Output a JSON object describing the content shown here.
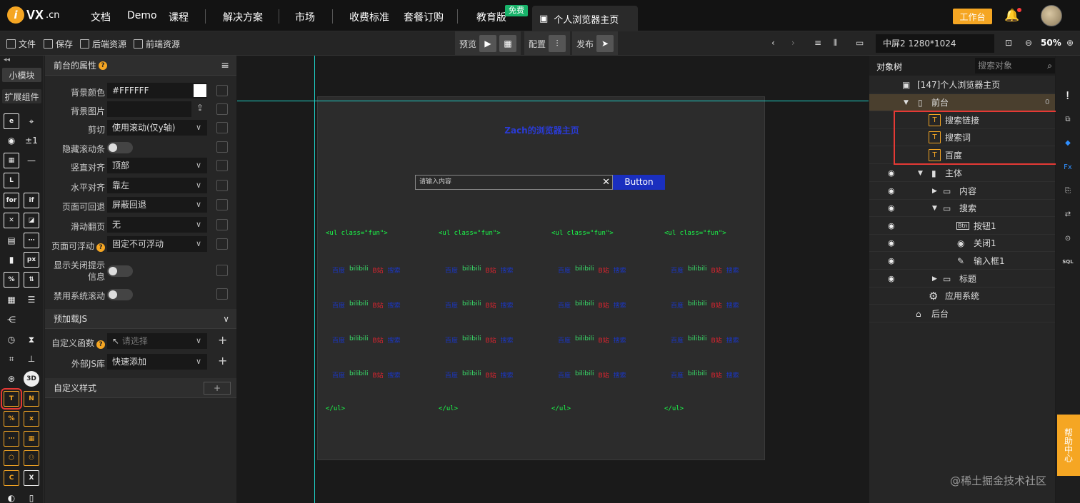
{
  "nav": {
    "logo_letter": "i",
    "logo_text": "VX",
    "logo_suffix": ".cn",
    "items": [
      "文档",
      "Demo",
      "课程",
      "解决方案",
      "市场",
      "收费标准",
      "套餐订购",
      "教育版"
    ],
    "free_badge": "免费",
    "page_tab": "个人浏览器主页",
    "workbench": "工作台"
  },
  "toolbar": {
    "file": "文件",
    "save": "保存",
    "backend": "后端资源",
    "frontend": "前端资源",
    "preview": "预览",
    "config": "配置",
    "publish": "发布",
    "resolution": "中屏2 1280*1024",
    "zoom": "50%"
  },
  "iconbar": {
    "tab_small": "小模块",
    "tab_ext": "扩展组件"
  },
  "props": {
    "header": "前台的属性",
    "bg_color_label": "背景颜色",
    "bg_color_value": "#FFFFFF",
    "bg_image_label": "背景图片",
    "clip_label": "剪切",
    "clip_value": "使用滚动(仅y轴)",
    "hide_scroll_label": "隐藏滚动条",
    "v_align_label": "竖直对齐",
    "v_align_value": "顶部",
    "h_align_label": "水平对齐",
    "h_align_value": "靠左",
    "back_label": "页面可回退",
    "back_value": "屏蔽回退",
    "swipe_label": "滑动翻页",
    "swipe_value": "无",
    "float_label": "页面可浮动",
    "float_value": "固定不可浮动",
    "close_tip_label_1": "显示关闭提示",
    "close_tip_label_2": "信息",
    "sys_scroll_label": "禁用系统滚动",
    "preload_header": "预加载JS",
    "custom_fn_label": "自定义函数",
    "custom_fn_placeholder": "请选择",
    "ext_js_label": "外部JS库",
    "ext_js_value": "快速添加",
    "custom_style_header": "自定义样式",
    "add": "+"
  },
  "canvas": {
    "title": "Zach的浏览器主页",
    "input_placeholder": "请输入内容",
    "button": "Button",
    "ul_open": "<ul class=\"fun\">",
    "ul_close": "</ul>",
    "link_a": "百度",
    "link_b": "bilibili",
    "link_c": "B站",
    "link_d": "搜索"
  },
  "tree": {
    "tab": "对象树",
    "search_placeholder": "搜索对象",
    "root": "[147]个人浏览器主页",
    "front": "前台",
    "front_count": "0",
    "t1": "搜索链接",
    "t2": "搜索词",
    "t3": "百度",
    "main": "主体",
    "content": "内容",
    "search": "搜索",
    "btn1": "按钮1",
    "close1": "关闭1",
    "input1": "输入框1",
    "title": "标题",
    "appsys": "应用系统",
    "backend": "后台"
  },
  "help": "帮助中心",
  "watermark": "@稀土掘金技术社区",
  "colors": {
    "accent": "#f5a623",
    "guide": "#1fd1c7",
    "highlight": "#e53935",
    "button": "#1a2fbf"
  }
}
